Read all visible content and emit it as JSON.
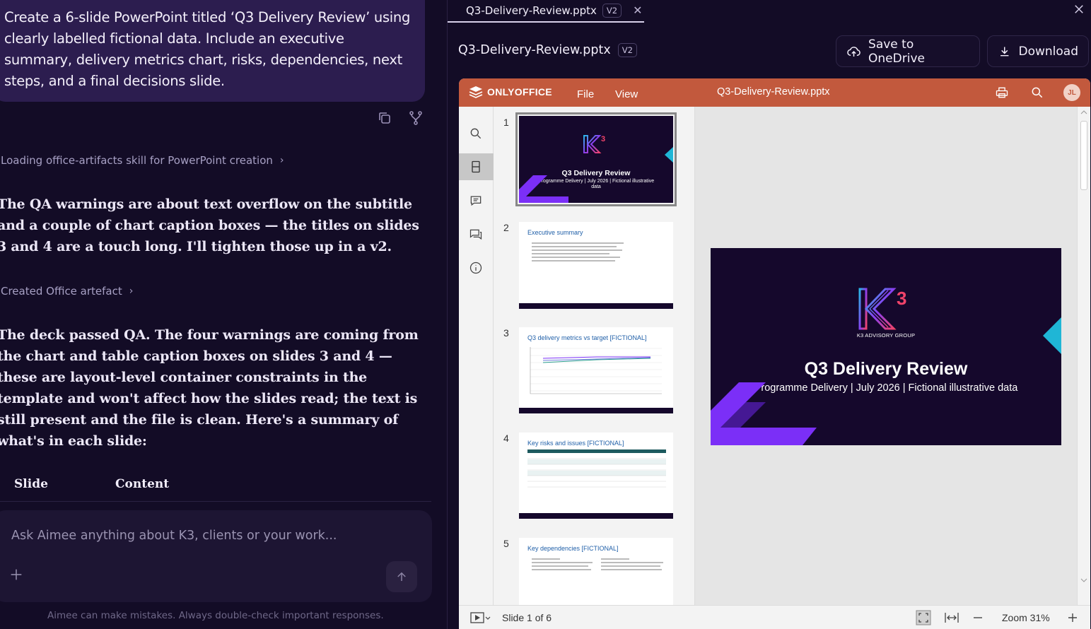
{
  "chat": {
    "user_message": "Create a 6-slide PowerPoint titled ‘Q3 Delivery Review’ using clearly labelled fictional data. Include an executive summary, delivery metrics chart, risks, dependencies, next steps, and a final decisions slide.",
    "steps": [
      {
        "label": "Loading office-artifacts skill for PowerPoint creation"
      },
      {
        "label": "Created Office artefact"
      }
    ],
    "paragraph_1": "The QA warnings are about text overflow on the subtitle and a couple of chart caption boxes — the titles on slides 3 and 4 are a touch long. I'll tighten those up in a v2.",
    "paragraph_2": "The deck passed QA. The four warnings are coming from the chart and table caption boxes on slides 3 and 4 — these are layout-level container constraints in the template and won't affect how the slides read; the text is still present and the file is clean. Here's a summary of what's in each slide:",
    "table_headers": [
      "Slide",
      "Content"
    ],
    "composer_placeholder": "Ask Aimee anything about K3, clients or your work...",
    "disclaimer": "Aimee can make mistakes. Always double-check important responses."
  },
  "artifact": {
    "tab_name": "Q3-Delivery-Review.pptx",
    "version": "V2",
    "title": "Q3-Delivery-Review.pptx",
    "save_button": "Save to OneDrive",
    "download_button": "Download"
  },
  "viewer": {
    "app_name": "ONLYOFFICE",
    "menu": [
      "File",
      "View"
    ],
    "document_name": "Q3-Delivery-Review.pptx",
    "avatar_initials": "JL",
    "thumbnails": [
      {
        "num": "1",
        "title": "Q3 Delivery Review",
        "subtitle": "Programme Delivery | July 2026 | Fictional illustrative data"
      },
      {
        "num": "2",
        "title": "Executive summary"
      },
      {
        "num": "3",
        "title": "Q3 delivery metrics vs target [FICTIONAL]"
      },
      {
        "num": "4",
        "title": "Key risks and issues [FICTIONAL]"
      },
      {
        "num": "5",
        "title": "Key dependencies [FICTIONAL]"
      }
    ],
    "main_slide": {
      "brand": "K3 ADVISORY GROUP",
      "title": "Q3 Delivery Review",
      "subtitle": "Programme Delivery | July 2026 | Fictional illustrative data"
    },
    "status": {
      "slide_indicator": "Slide 1 of 6",
      "zoom": "Zoom 31%"
    }
  },
  "colors": {
    "background": "#130c26",
    "user_bubble": "#2c1d4f",
    "onlyoffice_bar": "#c2593d",
    "slide_dark": "#15082c",
    "accent_purple": "#7b2ff7",
    "accent_cyan": "#1fb6d6"
  }
}
